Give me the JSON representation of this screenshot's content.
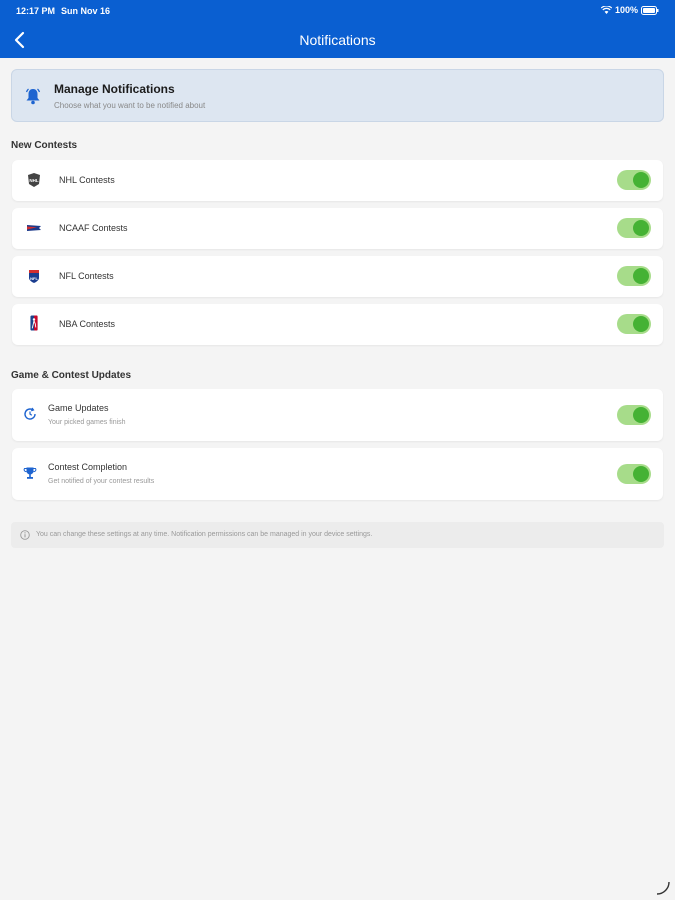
{
  "status_bar": {
    "time": "12:17 PM",
    "date": "Sun Nov 16",
    "battery": "100%",
    "icons": [
      "wifi-icon",
      "battery-icon"
    ]
  },
  "header": {
    "title": "Notifications",
    "back_icon": "chevron-left-icon",
    "background_color": "#0a5fd1"
  },
  "manage_card": {
    "icon": "bell-icon",
    "title": "Manage Notifications",
    "subtitle": "Choose what you want to be notified about"
  },
  "sections": {
    "new_contests": {
      "label": "New Contests",
      "items": [
        {
          "label": "NHL Contests",
          "icon": "nhl-logo-icon",
          "enabled": true
        },
        {
          "label": "NCAAF Contests",
          "icon": "ncaaf-logo-icon",
          "enabled": true
        },
        {
          "label": "NFL Contests",
          "icon": "nfl-logo-icon",
          "enabled": true
        },
        {
          "label": "NBA Contests",
          "icon": "nba-logo-icon",
          "enabled": true
        }
      ]
    },
    "updates": {
      "label": "Game & Contest Updates",
      "items": [
        {
          "label": "Game Updates",
          "subtitle": "Your picked games finish",
          "icon": "clock-refresh-icon",
          "enabled": true
        },
        {
          "label": "Contest Completion",
          "subtitle": "Get notified of your contest results",
          "icon": "trophy-icon",
          "enabled": true
        }
      ]
    }
  },
  "footer_note": {
    "icon": "info-icon",
    "text": "You can change these settings at any time. Notification permissions can be managed in your device settings."
  },
  "colors": {
    "toggle_track": "#a7dc8a",
    "toggle_knob": "#45b234"
  }
}
